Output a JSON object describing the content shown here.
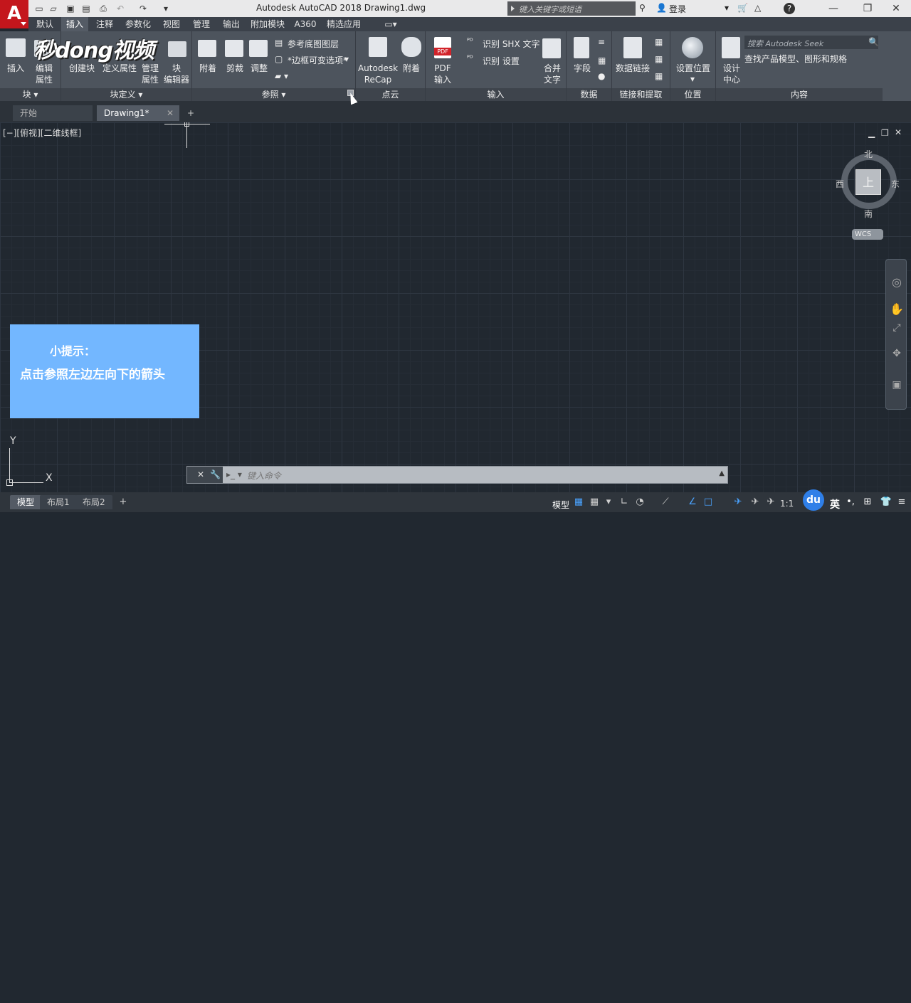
{
  "app": {
    "logo_letter": "A",
    "window_title": "Autodesk AutoCAD 2018    Drawing1.dwg",
    "search_placeholder": "键入关键字或短语",
    "login_label": "登录",
    "help_label": "?"
  },
  "ribbon_tabs": [
    "默认",
    "插入",
    "注释",
    "参数化",
    "视图",
    "管理",
    "输出",
    "附加模块",
    "A360",
    "精选应用"
  ],
  "active_tab": "插入",
  "watermark": "秒dong视频",
  "ribbon": {
    "block": {
      "insert": "插入",
      "edit_attr": "编辑\n属性",
      "footer": "块"
    },
    "block_def": {
      "create": "创建块",
      "define_attr": "定义属性",
      "manage_attr": "管理\n属性",
      "block_editor": "块\n编辑器",
      "footer": "块定义"
    },
    "reference": {
      "attach": "附着",
      "clip": "剪裁",
      "adjust": "调整",
      "underlay_layers": "参考底图图层",
      "frame_variable": "*边框可变选项*",
      "footer": "参照"
    },
    "pointcloud": {
      "recap": "Autodesk\nReCap",
      "attach": "附着",
      "footer": "点云"
    },
    "import": {
      "pdf_import": "PDF\n输入",
      "recognize_shx": "识别 SHX 文字",
      "recognize_settings": "识别 设置",
      "combine_text": "合并\n文字",
      "footer": "输入",
      "pdf_badge": "PDF"
    },
    "data": {
      "field": "字段",
      "footer": "数据"
    },
    "link": {
      "data_link": "数据链接",
      "footer": "链接和提取"
    },
    "location": {
      "set_location": "设置位置",
      "footer": "位置"
    },
    "content": {
      "design_center": "设计\n中心",
      "seek_placeholder": "搜索 Autodesk Seek",
      "seek_desc": "查找产品模型、图形和规格",
      "footer": "内容"
    }
  },
  "file_tabs": {
    "start": "开始",
    "drawing": "Drawing1*",
    "add": "+"
  },
  "viewport_label": "[−][俯视][二维线框]",
  "hint": {
    "title": "小提示：",
    "body": "点击参照左边左向下的箭头"
  },
  "viewcube": {
    "north": "北",
    "south": "南",
    "east": "东",
    "west": "西",
    "top": "上",
    "wcs": "WCS"
  },
  "ucs": {
    "x": "X",
    "y": "Y"
  },
  "command_placeholder": "键入命令",
  "layout_tabs": [
    "模型",
    "布局1",
    "布局2"
  ],
  "status": {
    "model": "模型",
    "scale": "1:1",
    "ime_badge": "du",
    "ime_lang": "英"
  }
}
